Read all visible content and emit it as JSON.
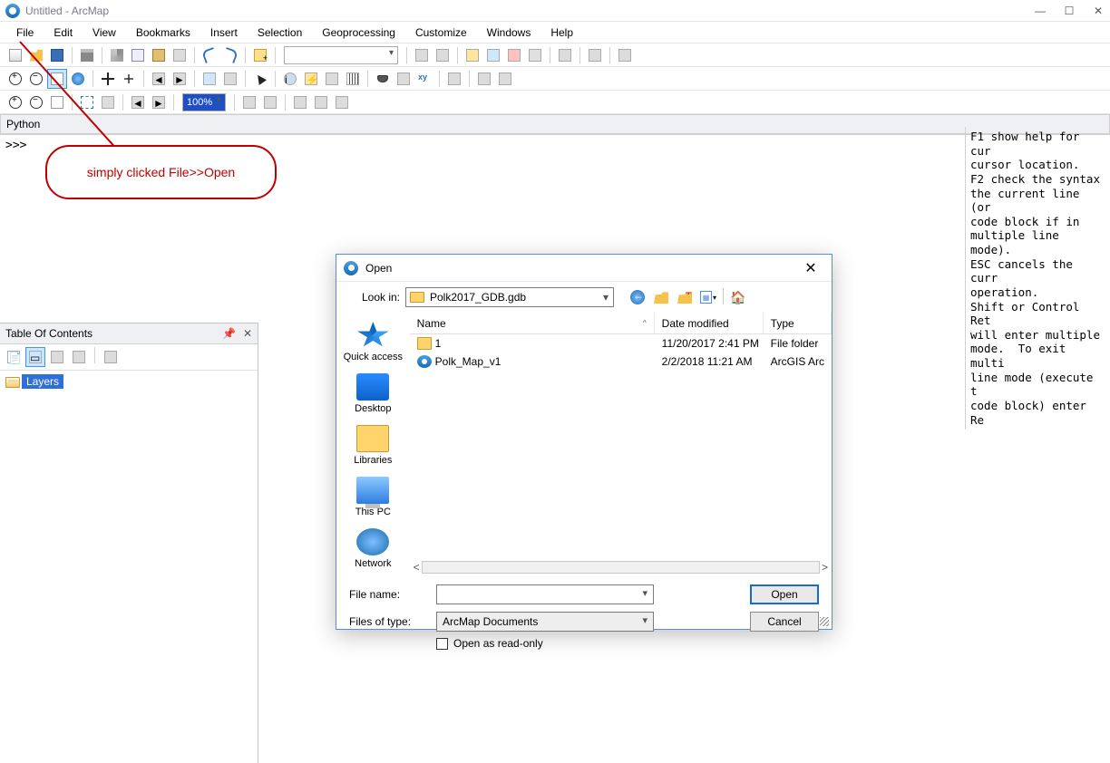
{
  "app": {
    "title": "Untitled - ArcMap"
  },
  "menubar": [
    "File",
    "Edit",
    "View",
    "Bookmarks",
    "Insert",
    "Selection",
    "Geoprocessing",
    "Customize",
    "Windows",
    "Help"
  ],
  "toolbar1": {
    "scale_value": ""
  },
  "toolbar3": {
    "zoom_value": "100%"
  },
  "python_panel": {
    "title": "Python",
    "prompt": ">>>"
  },
  "help_text": "F1 show help for cur\ncursor location.\nF2 check the syntax \nthe current line (or\ncode block if in\nmultiple line mode).\nESC cancels the curr\noperation.\nShift or Control Ret\nwill enter multiple \nmode.  To exit multi\nline mode (execute t\ncode block) enter Re",
  "callout": {
    "text": "simply clicked File>>Open"
  },
  "toc": {
    "title": "Table Of Contents",
    "root": "Layers"
  },
  "dialog": {
    "title": "Open",
    "lookin_label": "Look in:",
    "lookin_value": "Polk2017_GDB.gdb",
    "places": [
      {
        "id": "quickaccess",
        "label": "Quick access"
      },
      {
        "id": "desktop",
        "label": "Desktop"
      },
      {
        "id": "libraries",
        "label": "Libraries"
      },
      {
        "id": "thispc",
        "label": "This PC"
      },
      {
        "id": "network",
        "label": "Network"
      }
    ],
    "columns": {
      "name": "Name",
      "date": "Date modified",
      "type": "Type"
    },
    "rows": [
      {
        "icon": "folder",
        "name": "1",
        "date": "11/20/2017 2:41 PM",
        "type": "File folder"
      },
      {
        "icon": "mxd",
        "name": "Polk_Map_v1",
        "date": "2/2/2018 11:21 AM",
        "type": "ArcGIS Arc"
      }
    ],
    "file_name_label": "File name:",
    "file_name_value": "",
    "files_type_label": "Files of type:",
    "files_type_value": "ArcMap Documents",
    "readonly_label": "Open as read-only",
    "open_btn": "Open",
    "cancel_btn": "Cancel"
  }
}
